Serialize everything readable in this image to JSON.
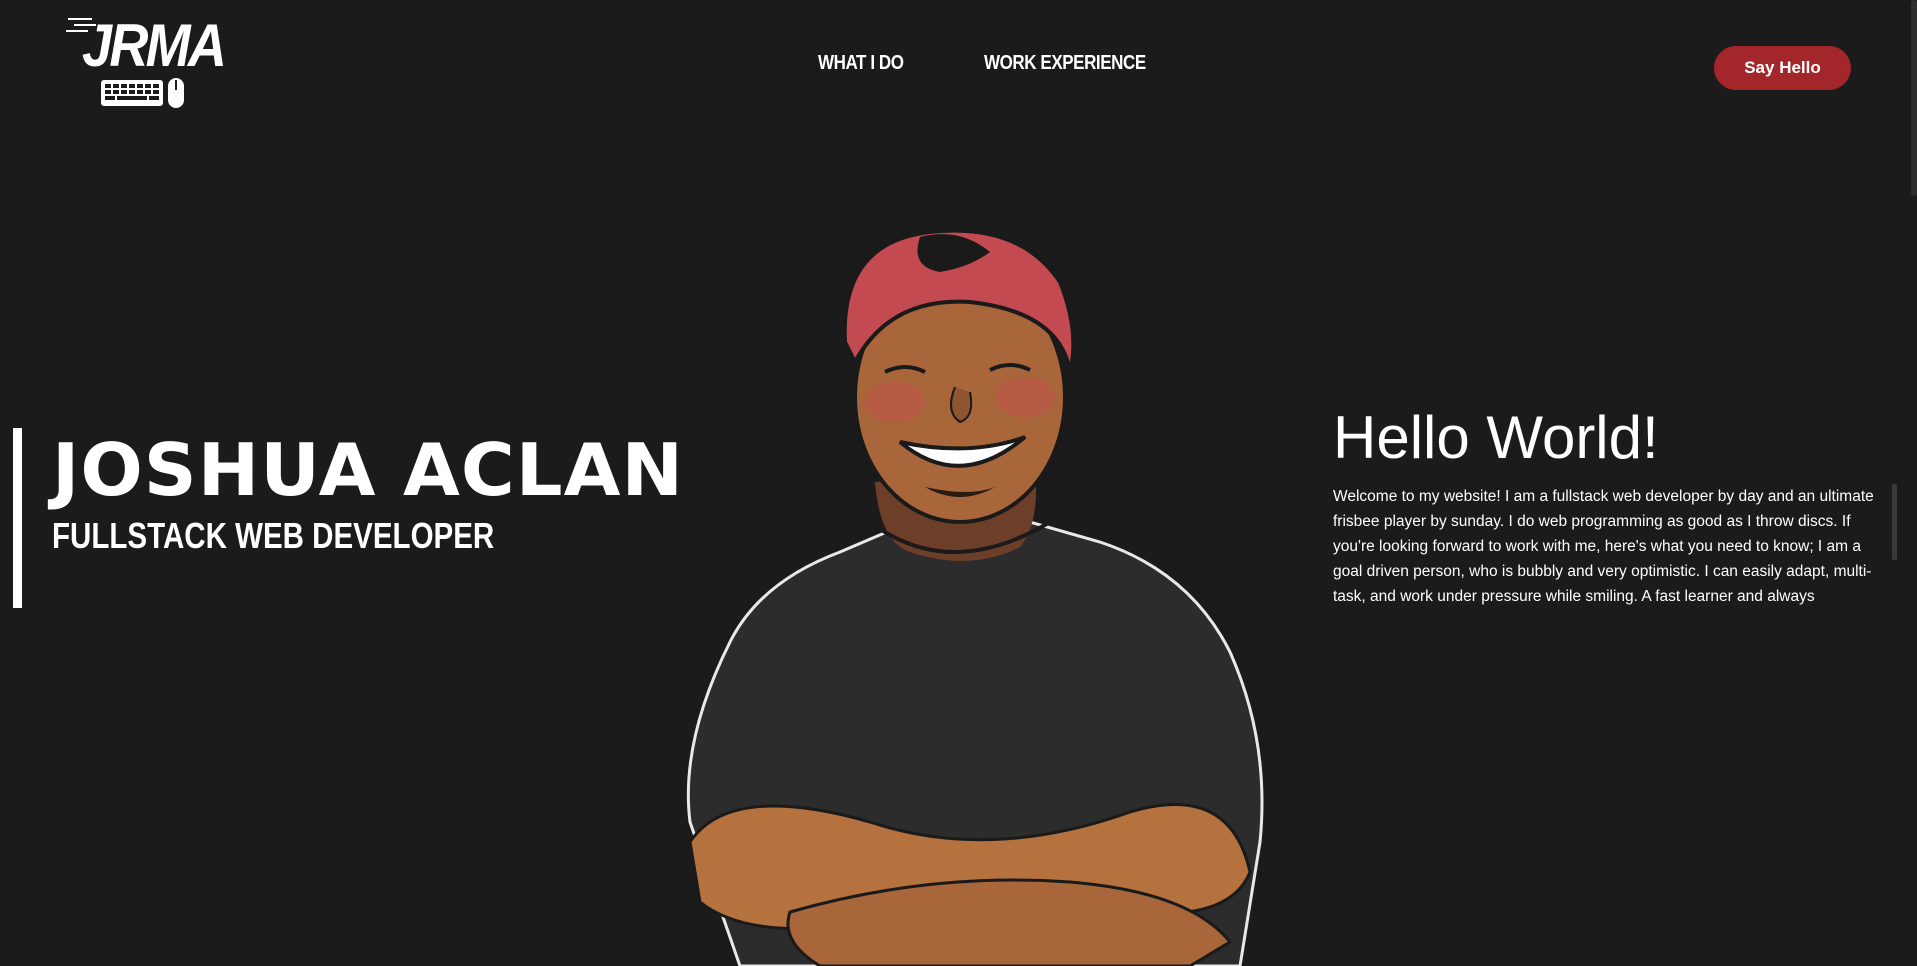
{
  "header": {
    "logo_text": "JRMA",
    "logo_icon": "keyboard-mouse-icon",
    "nav": [
      {
        "label": "WHAT I DO"
      },
      {
        "label": "WORK EXPERIENCE"
      }
    ],
    "cta_label": "Say Hello"
  },
  "hero": {
    "name": "JOSHUA ACLAN",
    "role": "FULLSTACK WEB DEVELOPER",
    "portrait": "illustrated-portrait-icon"
  },
  "about": {
    "title": "Hello World!",
    "text": "Welcome to my website! I am a fullstack web developer by day and an ultimate frisbee player by sunday. I do web programming as good as I throw discs. If you're looking forward to work with me, here's what you need to know; I am a goal driven person, who is bubbly and very optimistic. I can easily adapt, multi-task, and work under pressure while smiling. A fast learner and always"
  },
  "colors": {
    "background": "#1b1b1b",
    "accent": "#a3262a",
    "text": "#ffffff"
  }
}
